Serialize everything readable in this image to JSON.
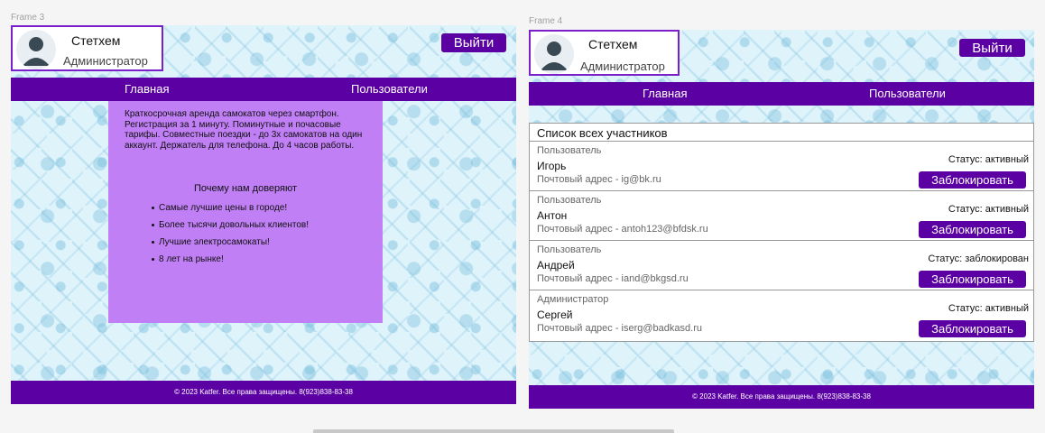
{
  "frames": [
    {
      "label": "Frame 3",
      "user": {
        "name": "Стетхем",
        "role": "Администратор"
      },
      "logout_label": "Выйти",
      "nav": {
        "home": "Главная",
        "users": "Пользователи"
      },
      "promo": {
        "text": "Краткосрочная аренда самокатов через смартфон. Регистрация за 1 минуту. Поминутные и почасовые тарифы. Совместные поездки - до 3х самокатов на один аккаунт. Держатель для телефона. До 4 часов работы.",
        "heading": "Почему нам доверяют",
        "items": [
          "Самые лучшие цены в городе!",
          "Более тысячи довольных клиентов!",
          "Лучшие электросамокаты!",
          "8 лет на рынке!"
        ]
      },
      "footer": "© 2023 Katfer. Все права защищены. 8(923)838-83-38"
    },
    {
      "label": "Frame 4",
      "user": {
        "name": "Стетхем",
        "role": "Администратор"
      },
      "logout_label": "Выйти",
      "nav": {
        "home": "Главная",
        "users": "Пользователи"
      },
      "users_list": {
        "title": "Список всех участников",
        "block_label": "Заблокировать",
        "rows": [
          {
            "type": "Пользователь",
            "name": "Игорь",
            "email": "Почтовый адрес - ig@bk.ru",
            "status": "Статус: активный"
          },
          {
            "type": "Пользователь",
            "name": "Антон",
            "email": "Почтовый адрес - antoh123@bfdsk.ru",
            "status": "Статус: активный"
          },
          {
            "type": "Пользователь",
            "name": "Андрей",
            "email": "Почтовый адрес - iand@bkgsd.ru",
            "status": "Статус: заблокирован"
          },
          {
            "type": "Администратор",
            "name": "Сергей",
            "email": "Почтовый адрес - iserg@badkasd.ru",
            "status": "Статус: активный"
          }
        ]
      },
      "footer": "© 2023 Katfer. Все права защищены. 8(923)838-83-38"
    }
  ],
  "colors": {
    "accent": "#5b00a3",
    "promo_bg": "#c07ff5",
    "border": "#7a1fc9",
    "pattern_bg": "#dff3fb"
  }
}
